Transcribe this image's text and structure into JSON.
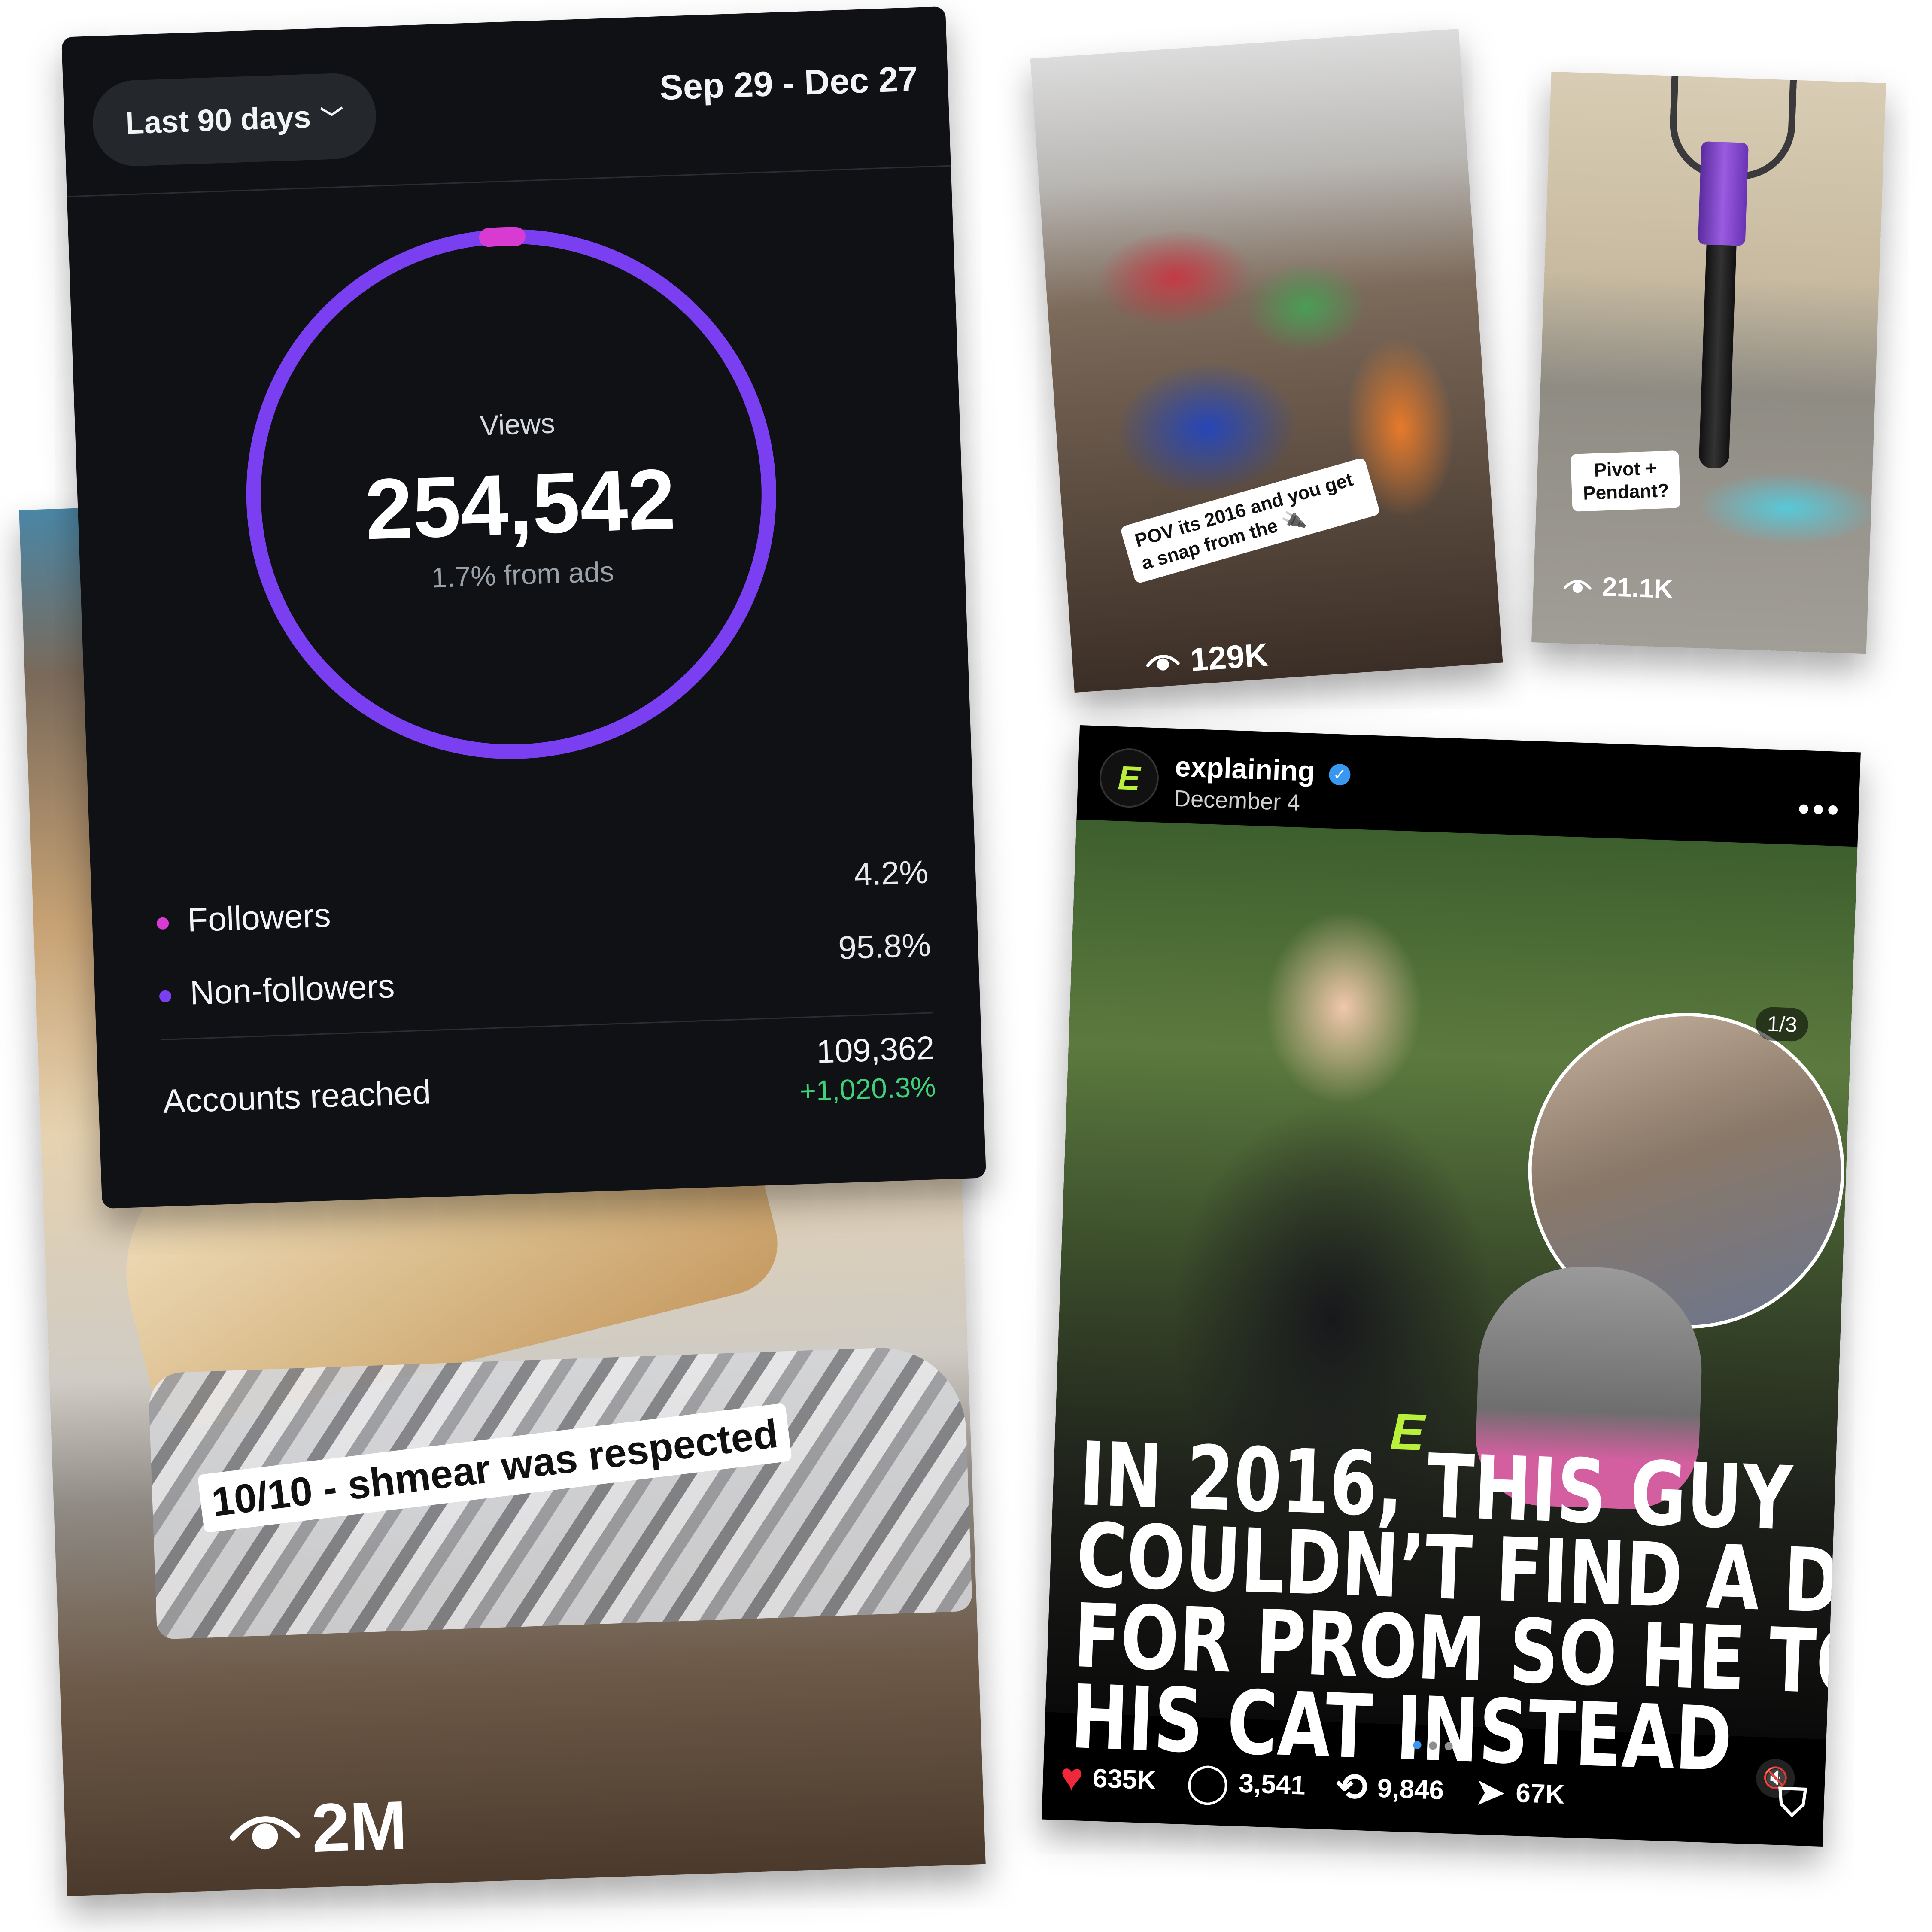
{
  "food_video": {
    "caption": "10/10 - shmear was respected",
    "views": "2M",
    "eye_icon": "eye-icon"
  },
  "insights": {
    "range_label": "Last 90 days",
    "range_chevron": "chevron-down-icon",
    "date_range": "Sep 29 - Dec 27",
    "views_label": "Views",
    "views_value": "254,542",
    "ads_note": "1.7% from ads",
    "ads_fraction": 0.017,
    "ring_color": "#7b3ff2",
    "ads_color": "#d83bd2",
    "legend": [
      {
        "label": "Followers",
        "value": "4.2%",
        "color": "#d83bd2"
      },
      {
        "label": "Non-followers",
        "value": "95.8%",
        "color": "#7b3ff2"
      }
    ],
    "accounts_reached_label": "Accounts reached",
    "accounts_reached_value": "109,362",
    "accounts_reached_change": "+1,020.3%",
    "change_color": "#3dd17a"
  },
  "beads_video": {
    "caption": "POV its 2016 and you get a snap from the 🔌",
    "views": "129K"
  },
  "pendant_video": {
    "caption_line1": "Pivot +",
    "caption_line2": "Pendant?",
    "views": "21.1K"
  },
  "post": {
    "avatar_letter": "E",
    "username": "explaining",
    "verified_icon": "verified-badge-icon",
    "date": "December 4",
    "more_glyph": "•••",
    "slide_counter": "1/3",
    "brand_mark": "E",
    "headline_lines": [
      "IN 2016, THIS GUY",
      "COULDN’T FIND A DATE",
      "FOR PROM SO HE TOOK",
      "HIS CAT INSTEAD"
    ],
    "likes": "635K",
    "comments": "3,541",
    "reposts": "9,846",
    "shares": "67K"
  }
}
